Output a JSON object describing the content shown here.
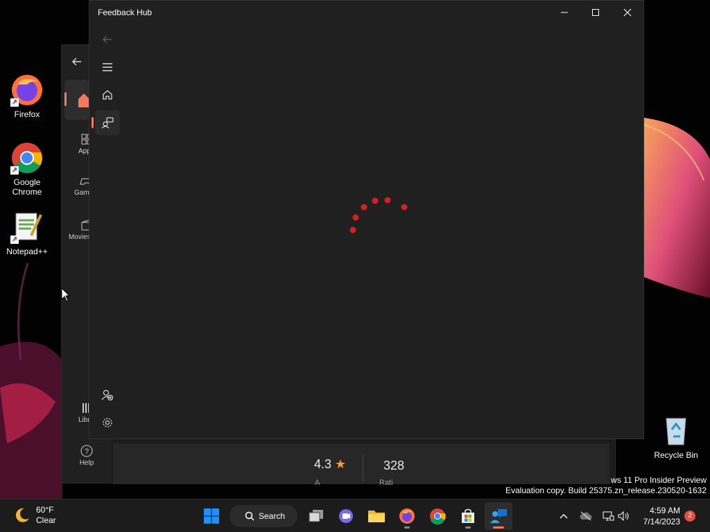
{
  "desktop": {
    "icons": [
      {
        "label": "Firefox"
      },
      {
        "label": "Google Chrome"
      },
      {
        "label": "Notepad++"
      },
      {
        "label": "Recycle Bin"
      }
    ],
    "watermark": {
      "line1": "ws 11 Pro Insider Preview",
      "line2": "Evaluation copy. Build 25375.zn_release.230520-1632"
    }
  },
  "store_window": {
    "nav": [
      {
        "label": "Home",
        "icon": "home-icon"
      },
      {
        "label": "App",
        "icon": "apps-icon"
      },
      {
        "label": "Gam",
        "icon": "gaming-icon"
      },
      {
        "label": "Movies",
        "icon": "movies-icon"
      },
      {
        "label": "Libra",
        "icon": "library-icon"
      },
      {
        "label": "Help",
        "icon": "help-icon"
      }
    ],
    "rating": "4.3",
    "rating_count": "328",
    "rating_sub": "A",
    "count_sub": "Rati"
  },
  "feedback_hub": {
    "title": "Feedback Hub",
    "sidebar": [
      "back-icon",
      "menu-icon",
      "home-icon",
      "feedback-icon",
      "add-account-icon",
      "settings-icon"
    ],
    "accent": "#f07a5c",
    "spinner_color": "#d42020"
  },
  "taskbar": {
    "weather": {
      "temp": "60°F",
      "condition": "Clear"
    },
    "search_label": "Search",
    "clock": {
      "time": "4:59 AM",
      "date": "7/14/2023"
    },
    "notification_count": "2"
  }
}
